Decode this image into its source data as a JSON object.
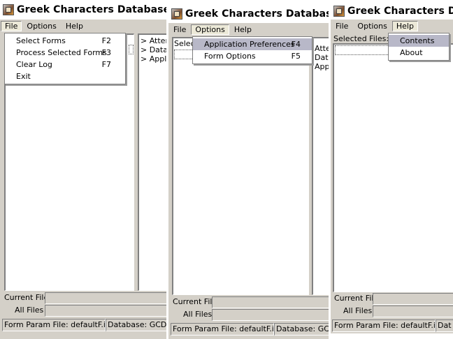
{
  "window_title": "Greek Characters Database Input",
  "menus": {
    "file": "File",
    "options": "Options",
    "help": "Help"
  },
  "file_menu": [
    {
      "label": "Select Forms",
      "shortcut": "F2"
    },
    {
      "label": "Process Selected Forms",
      "shortcut": "F3"
    },
    {
      "label": "Clear Log",
      "shortcut": "F7"
    },
    {
      "label": "Exit",
      "shortcut": ""
    }
  ],
  "options_menu": [
    {
      "label": "Application Preferences",
      "shortcut": "F4"
    },
    {
      "label": "Form Options",
      "shortcut": "F5"
    }
  ],
  "help_menu": [
    {
      "label": "Contents"
    },
    {
      "label": "About"
    }
  ],
  "left_tree": [
    "> Atten",
    "> Datab",
    "> Applic"
  ],
  "mid_tree": [
    "Atter",
    "Data",
    "Appl"
  ],
  "selected_files_label": "Selected Files:",
  "selected_files_label_cut": "Selec",
  "current_file_label": "Current File:",
  "all_files_label": "All Files :",
  "status": {
    "form_param": "Form Param File: defaultF.ini",
    "database": "Database: GCDB",
    "database_cut": "Dat"
  }
}
